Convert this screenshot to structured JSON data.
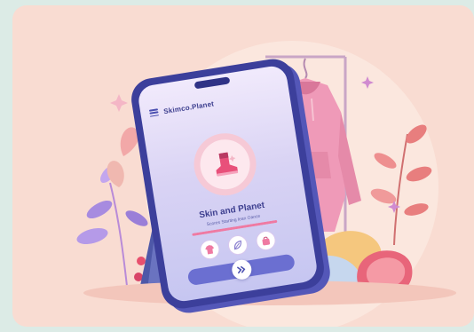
{
  "app": {
    "title": "Skimco.Planet",
    "headline": "Skin and Planet",
    "subtitle": "Scores Starting lean Oance"
  },
  "progress": {
    "value": 1.0
  },
  "icons": {
    "menu": "menu-icon",
    "badge": "boot-icon",
    "shortcuts": [
      "jacket-icon",
      "leaf-icon",
      "bag-icon"
    ],
    "action": "double-chevron-icon"
  },
  "colors": {
    "background": "#dcebe6",
    "card": "#f9dcd2",
    "phone_frame": "#3c3f9b",
    "accent_pink": "#ef7aa2",
    "accent_purple": "#6b6fd1",
    "hoodie": "#ef9ab8"
  }
}
